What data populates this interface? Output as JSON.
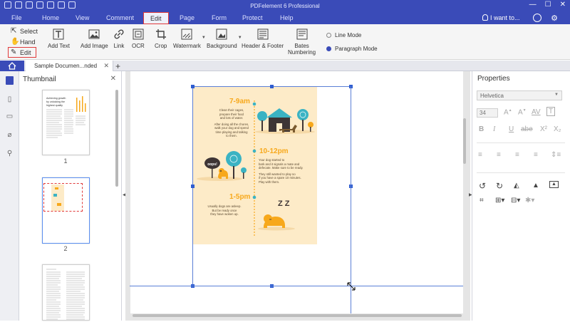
{
  "window": {
    "title": "PDFelement 6 Professional",
    "controls": [
      "—",
      "☐",
      "✕"
    ]
  },
  "menu": {
    "items": [
      "File",
      "Home",
      "View",
      "Comment",
      "Edit",
      "Page",
      "Form",
      "Protect",
      "Help"
    ],
    "active": "Edit",
    "search_label": "I want to..."
  },
  "ribbon": {
    "modes": {
      "select": "Select",
      "hand": "Hand",
      "edit": "Edit"
    },
    "tools": {
      "add_text": "Add Text",
      "add_image": "Add Image",
      "link": "Link",
      "ocr": "OCR",
      "crop": "Crop",
      "watermark": "Watermark",
      "background": "Background",
      "header_footer": "Header & Footer",
      "bates_1": "Bates",
      "bates_2": "Numbering"
    },
    "edit_mode": {
      "line": "Line Mode",
      "paragraph": "Paragraph Mode",
      "selected": "Paragraph Mode"
    }
  },
  "tabs": {
    "document": "Sample Documen...nded",
    "close": "✕",
    "new": "+"
  },
  "thumbnail_panel": {
    "title": "Thumbnail",
    "close": "✕",
    "pages": [
      "1",
      "2"
    ],
    "selected": "2"
  },
  "page_content": {
    "thumb1": {
      "title_1": "Achieving growth",
      "title_2": "by unlocking the",
      "title_3": "highest quality"
    },
    "sections": [
      {
        "time": "7-9am",
        "text_1": "Clean their cages,",
        "text_2": "prepare their food",
        "text_3": "and lots of water.",
        "text_4": "After doing all the chores,",
        "text_5": "walk your dog and spend",
        "text_6": "time playing and talking",
        "text_7": "to them."
      },
      {
        "time": "10-12pm",
        "text_1": "Your dog started to",
        "text_2": "bark and it signals a mate and",
        "text_3": "defecate. Make sure to be ready.",
        "text_4": "They still wanted to play so",
        "text_5": "if you have a spare 10 minutes.",
        "text_6": "Play with them.",
        "sign": "oops!"
      },
      {
        "time": "1-5pm",
        "text_1": "Usually dogs are asleep.",
        "text_2": "But be ready once",
        "text_3": "they have woken up."
      }
    ],
    "zzz": "Z Z"
  },
  "properties": {
    "title": "Properties",
    "font": "Helvetica",
    "size": "34",
    "style_buttons": [
      "B",
      "I",
      "U",
      "abe",
      "X²",
      "X₂"
    ]
  },
  "colors": {
    "titlebar": "#3a4bb8",
    "highlight": "#e13a3a",
    "poster_bg": "#fdebc8",
    "accent_orange": "#f7a81b",
    "accent_teal": "#3bb3c3",
    "house": "#3e3535",
    "dog": "#7a5a2f"
  }
}
